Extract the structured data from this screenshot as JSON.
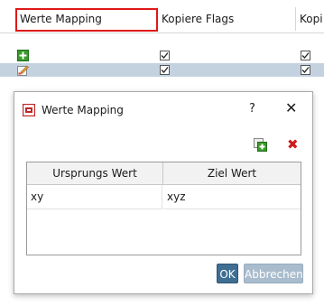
{
  "grid": {
    "columns": [
      "Werte Mapping",
      "Kopiere Flags",
      "Kopi"
    ],
    "rows": [
      {
        "icon": "add-row-icon",
        "flag1": true,
        "flag2": true
      },
      {
        "icon": "edit-row-icon",
        "flag1": true,
        "flag2": true,
        "selected": true
      }
    ]
  },
  "dialog": {
    "title": "Werte Mapping",
    "help": "?",
    "close": "✕",
    "toolbar": {
      "add_icon": "add-row-icon",
      "delete_icon": "delete-icon",
      "delete_glyph": "✖"
    },
    "table": {
      "headers": [
        "Ursprungs Wert",
        "Ziel Wert"
      ],
      "rows": [
        [
          "xy",
          "xyz"
        ]
      ]
    },
    "ok_label": "OK",
    "cancel_label": "Abbrechen"
  },
  "colors": {
    "highlight": "#e01818",
    "selected_row": "#c4d2e0",
    "ok": "#3f6e93",
    "cancel": "#a9bccd"
  }
}
